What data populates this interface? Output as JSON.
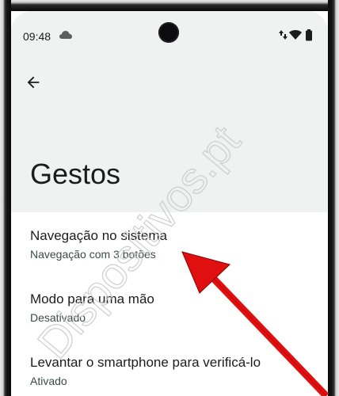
{
  "status_bar": {
    "time": "09:48",
    "icons": [
      "cloud-icon",
      "data-arrows-icon",
      "wifi-icon",
      "battery-icon"
    ]
  },
  "header": {
    "back_icon": "arrow-left-icon",
    "title": "Gestos",
    "background": "#f0f2f1"
  },
  "settings": {
    "items": [
      {
        "title": "Navegação no sistema",
        "summary": "Navegação com 3 botões"
      },
      {
        "title": "Modo para uma mão",
        "summary": "Desativado"
      },
      {
        "title": "Levantar o smartphone para verificá-lo",
        "summary": "Ativado"
      }
    ]
  },
  "watermark": {
    "text": "Dispositivos.pt"
  },
  "annotation": {
    "type": "arrow",
    "color": "#e01010"
  }
}
